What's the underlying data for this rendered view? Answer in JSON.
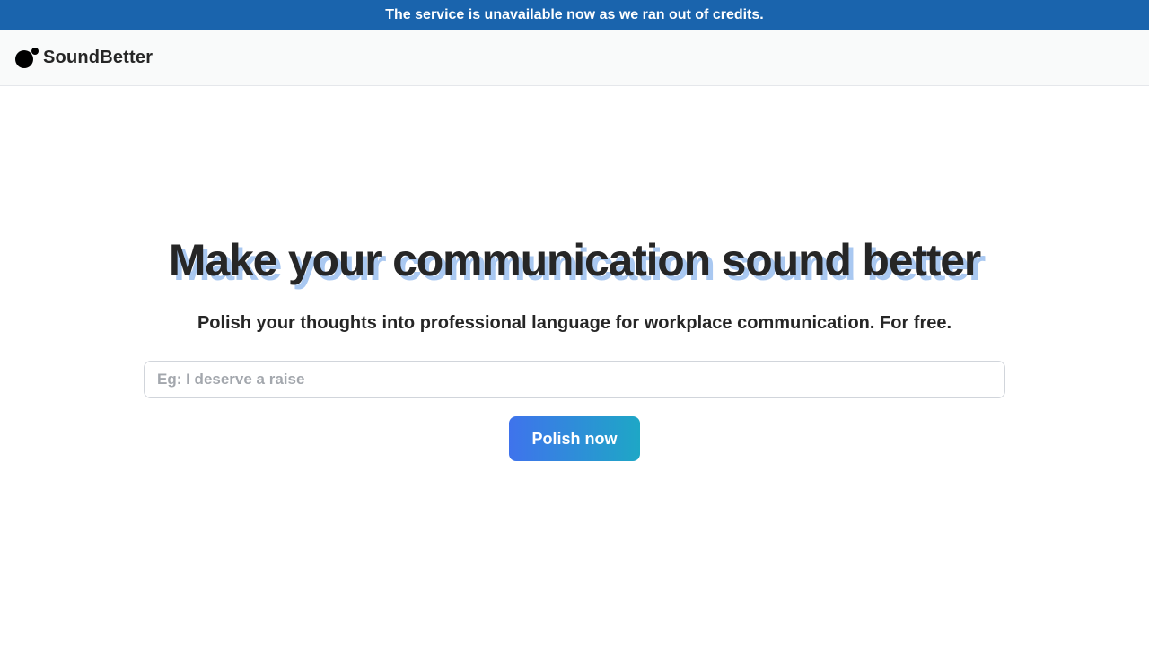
{
  "banner": {
    "text": "The service is unavailable now as we ran out of credits."
  },
  "navbar": {
    "brand_name": "SoundBetter",
    "logo_icon": "two-dots-logo-icon"
  },
  "hero": {
    "headline": "Make your communication sound better",
    "subhead": "Polish your thoughts into professional language for workplace communication. For free.",
    "input_placeholder": "Eg: I deserve a raise",
    "input_value": "",
    "button_label": "Polish now"
  },
  "colors": {
    "banner_bg": "#1a64ad",
    "headline_shadow": "#a9c8f1",
    "button_gradient_start": "#3f73ec",
    "button_gradient_end": "#1ea7c6"
  }
}
